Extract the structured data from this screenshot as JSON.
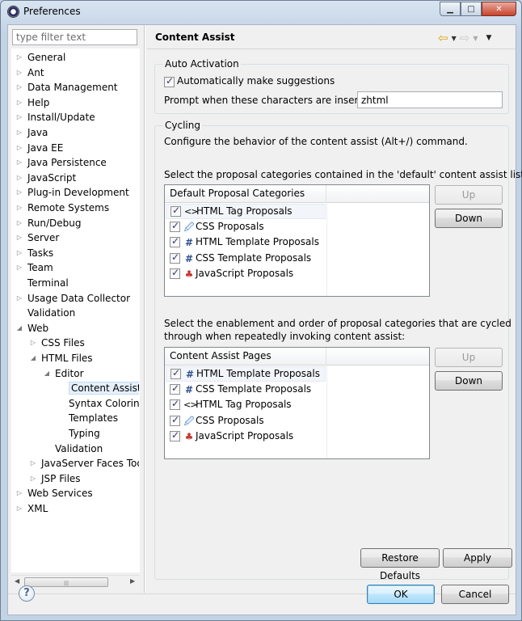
{
  "window": {
    "title": "Preferences"
  },
  "filter": {
    "placeholder": "type filter text"
  },
  "tree": [
    {
      "label": "General",
      "level": 0,
      "twisty": "collapsed"
    },
    {
      "label": "Ant",
      "level": 0,
      "twisty": "collapsed"
    },
    {
      "label": "Data Management",
      "level": 0,
      "twisty": "collapsed"
    },
    {
      "label": "Help",
      "level": 0,
      "twisty": "collapsed"
    },
    {
      "label": "Install/Update",
      "level": 0,
      "twisty": "collapsed"
    },
    {
      "label": "Java",
      "level": 0,
      "twisty": "collapsed"
    },
    {
      "label": "Java EE",
      "level": 0,
      "twisty": "collapsed"
    },
    {
      "label": "Java Persistence",
      "level": 0,
      "twisty": "collapsed"
    },
    {
      "label": "JavaScript",
      "level": 0,
      "twisty": "collapsed"
    },
    {
      "label": "Plug-in Development",
      "level": 0,
      "twisty": "collapsed"
    },
    {
      "label": "Remote Systems",
      "level": 0,
      "twisty": "collapsed"
    },
    {
      "label": "Run/Debug",
      "level": 0,
      "twisty": "collapsed"
    },
    {
      "label": "Server",
      "level": 0,
      "twisty": "collapsed"
    },
    {
      "label": "Tasks",
      "level": 0,
      "twisty": "collapsed"
    },
    {
      "label": "Team",
      "level": 0,
      "twisty": "collapsed"
    },
    {
      "label": "Terminal",
      "level": 0,
      "twisty": "none"
    },
    {
      "label": "Usage Data Collector",
      "level": 0,
      "twisty": "collapsed"
    },
    {
      "label": "Validation",
      "level": 0,
      "twisty": "none"
    },
    {
      "label": "Web",
      "level": 0,
      "twisty": "expanded"
    },
    {
      "label": "CSS Files",
      "level": 1,
      "twisty": "collapsed"
    },
    {
      "label": "HTML Files",
      "level": 1,
      "twisty": "expanded"
    },
    {
      "label": "Editor",
      "level": 2,
      "twisty": "expanded"
    },
    {
      "label": "Content Assist",
      "level": 3,
      "twisty": "none",
      "selected": true
    },
    {
      "label": "Syntax Coloring",
      "level": 3,
      "twisty": "none"
    },
    {
      "label": "Templates",
      "level": 3,
      "twisty": "none"
    },
    {
      "label": "Typing",
      "level": 3,
      "twisty": "none"
    },
    {
      "label": "Validation",
      "level": 2,
      "twisty": "none"
    },
    {
      "label": "JavaServer Faces Tools",
      "level": 1,
      "twisty": "collapsed"
    },
    {
      "label": "JSP Files",
      "level": 1,
      "twisty": "collapsed"
    },
    {
      "label": "Web Services",
      "level": 0,
      "twisty": "collapsed"
    },
    {
      "label": "XML",
      "level": 0,
      "twisty": "collapsed"
    }
  ],
  "page": {
    "title": "Content Assist"
  },
  "auto_activation": {
    "group_title": "Auto Activation",
    "checkbox_label": "Automatically make suggestions",
    "checked": true,
    "prompt_label": "Prompt when these characters are inserted:",
    "prompt_value": "zhtml"
  },
  "cycling": {
    "group_title": "Cycling",
    "description": "Configure the behavior of the content assist (Alt+/) command."
  },
  "default_list": {
    "caption": "Select the proposal categories contained in the 'default' content assist list:",
    "header": "Default Proposal Categories",
    "rows": [
      {
        "icon": "tag-icon",
        "glyph": "<>",
        "label": "HTML Tag Proposals",
        "checked": true
      },
      {
        "icon": "css-icon",
        "glyph": "🖉",
        "label": "CSS Proposals",
        "checked": true
      },
      {
        "icon": "template-icon",
        "glyph": "#",
        "label": "HTML Template Proposals",
        "checked": true
      },
      {
        "icon": "template-icon",
        "glyph": "#",
        "label": "CSS Template Proposals",
        "checked": true
      },
      {
        "icon": "javascript-icon",
        "glyph": "♣",
        "label": "JavaScript Proposals",
        "checked": true
      }
    ],
    "up_label": "Up",
    "down_label": "Down"
  },
  "cycle_list": {
    "caption_line1": "Select the enablement and order of proposal categories that are cycled",
    "caption_line2": "through when repeatedly invoking content assist:",
    "header": "Content Assist Pages",
    "rows": [
      {
        "icon": "template-icon",
        "glyph": "#",
        "label": "HTML Template Proposals",
        "checked": true
      },
      {
        "icon": "template-icon",
        "glyph": "#",
        "label": "CSS Template Proposals",
        "checked": true
      },
      {
        "icon": "tag-icon",
        "glyph": "<>",
        "label": "HTML Tag Proposals",
        "checked": true
      },
      {
        "icon": "css-icon",
        "glyph": "🖉",
        "label": "CSS Proposals",
        "checked": true
      },
      {
        "icon": "javascript-icon",
        "glyph": "♣",
        "label": "JavaScript Proposals",
        "checked": true
      }
    ],
    "up_label": "Up",
    "down_label": "Down"
  },
  "buttons": {
    "restore_defaults": "Restore Defaults",
    "apply": "Apply",
    "ok": "OK",
    "cancel": "Cancel"
  },
  "colors": {
    "title_bar": "#c7d6e8",
    "selection": "#e5f0fb",
    "default_button": "#bee6fd",
    "close_button": "#c7442e"
  }
}
